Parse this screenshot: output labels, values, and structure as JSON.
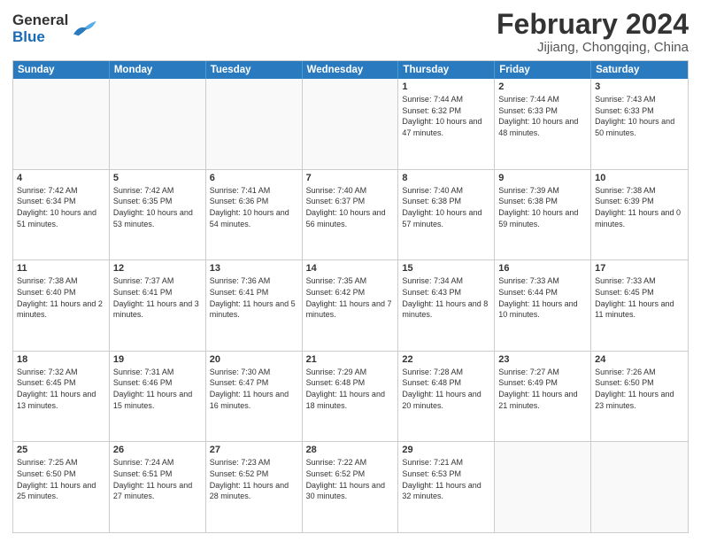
{
  "header": {
    "logo": {
      "general": "General",
      "blue": "Blue"
    },
    "title": "February 2024",
    "location": "Jijiang, Chongqing, China"
  },
  "weekdays": [
    "Sunday",
    "Monday",
    "Tuesday",
    "Wednesday",
    "Thursday",
    "Friday",
    "Saturday"
  ],
  "weeks": [
    [
      {
        "day": "",
        "empty": true
      },
      {
        "day": "",
        "empty": true
      },
      {
        "day": "",
        "empty": true
      },
      {
        "day": "",
        "empty": true
      },
      {
        "day": "1",
        "sunrise": "7:44 AM",
        "sunset": "6:32 PM",
        "daylight": "10 hours and 47 minutes."
      },
      {
        "day": "2",
        "sunrise": "7:44 AM",
        "sunset": "6:33 PM",
        "daylight": "10 hours and 48 minutes."
      },
      {
        "day": "3",
        "sunrise": "7:43 AM",
        "sunset": "6:33 PM",
        "daylight": "10 hours and 50 minutes."
      }
    ],
    [
      {
        "day": "4",
        "sunrise": "7:42 AM",
        "sunset": "6:34 PM",
        "daylight": "10 hours and 51 minutes."
      },
      {
        "day": "5",
        "sunrise": "7:42 AM",
        "sunset": "6:35 PM",
        "daylight": "10 hours and 53 minutes."
      },
      {
        "day": "6",
        "sunrise": "7:41 AM",
        "sunset": "6:36 PM",
        "daylight": "10 hours and 54 minutes."
      },
      {
        "day": "7",
        "sunrise": "7:40 AM",
        "sunset": "6:37 PM",
        "daylight": "10 hours and 56 minutes."
      },
      {
        "day": "8",
        "sunrise": "7:40 AM",
        "sunset": "6:38 PM",
        "daylight": "10 hours and 57 minutes."
      },
      {
        "day": "9",
        "sunrise": "7:39 AM",
        "sunset": "6:38 PM",
        "daylight": "10 hours and 59 minutes."
      },
      {
        "day": "10",
        "sunrise": "7:38 AM",
        "sunset": "6:39 PM",
        "daylight": "11 hours and 0 minutes."
      }
    ],
    [
      {
        "day": "11",
        "sunrise": "7:38 AM",
        "sunset": "6:40 PM",
        "daylight": "11 hours and 2 minutes."
      },
      {
        "day": "12",
        "sunrise": "7:37 AM",
        "sunset": "6:41 PM",
        "daylight": "11 hours and 3 minutes."
      },
      {
        "day": "13",
        "sunrise": "7:36 AM",
        "sunset": "6:41 PM",
        "daylight": "11 hours and 5 minutes."
      },
      {
        "day": "14",
        "sunrise": "7:35 AM",
        "sunset": "6:42 PM",
        "daylight": "11 hours and 7 minutes."
      },
      {
        "day": "15",
        "sunrise": "7:34 AM",
        "sunset": "6:43 PM",
        "daylight": "11 hours and 8 minutes."
      },
      {
        "day": "16",
        "sunrise": "7:33 AM",
        "sunset": "6:44 PM",
        "daylight": "11 hours and 10 minutes."
      },
      {
        "day": "17",
        "sunrise": "7:33 AM",
        "sunset": "6:45 PM",
        "daylight": "11 hours and 11 minutes."
      }
    ],
    [
      {
        "day": "18",
        "sunrise": "7:32 AM",
        "sunset": "6:45 PM",
        "daylight": "11 hours and 13 minutes."
      },
      {
        "day": "19",
        "sunrise": "7:31 AM",
        "sunset": "6:46 PM",
        "daylight": "11 hours and 15 minutes."
      },
      {
        "day": "20",
        "sunrise": "7:30 AM",
        "sunset": "6:47 PM",
        "daylight": "11 hours and 16 minutes."
      },
      {
        "day": "21",
        "sunrise": "7:29 AM",
        "sunset": "6:48 PM",
        "daylight": "11 hours and 18 minutes."
      },
      {
        "day": "22",
        "sunrise": "7:28 AM",
        "sunset": "6:48 PM",
        "daylight": "11 hours and 20 minutes."
      },
      {
        "day": "23",
        "sunrise": "7:27 AM",
        "sunset": "6:49 PM",
        "daylight": "11 hours and 21 minutes."
      },
      {
        "day": "24",
        "sunrise": "7:26 AM",
        "sunset": "6:50 PM",
        "daylight": "11 hours and 23 minutes."
      }
    ],
    [
      {
        "day": "25",
        "sunrise": "7:25 AM",
        "sunset": "6:50 PM",
        "daylight": "11 hours and 25 minutes."
      },
      {
        "day": "26",
        "sunrise": "7:24 AM",
        "sunset": "6:51 PM",
        "daylight": "11 hours and 27 minutes."
      },
      {
        "day": "27",
        "sunrise": "7:23 AM",
        "sunset": "6:52 PM",
        "daylight": "11 hours and 28 minutes."
      },
      {
        "day": "28",
        "sunrise": "7:22 AM",
        "sunset": "6:52 PM",
        "daylight": "11 hours and 30 minutes."
      },
      {
        "day": "29",
        "sunrise": "7:21 AM",
        "sunset": "6:53 PM",
        "daylight": "11 hours and 32 minutes."
      },
      {
        "day": "",
        "empty": true
      },
      {
        "day": "",
        "empty": true
      }
    ]
  ]
}
